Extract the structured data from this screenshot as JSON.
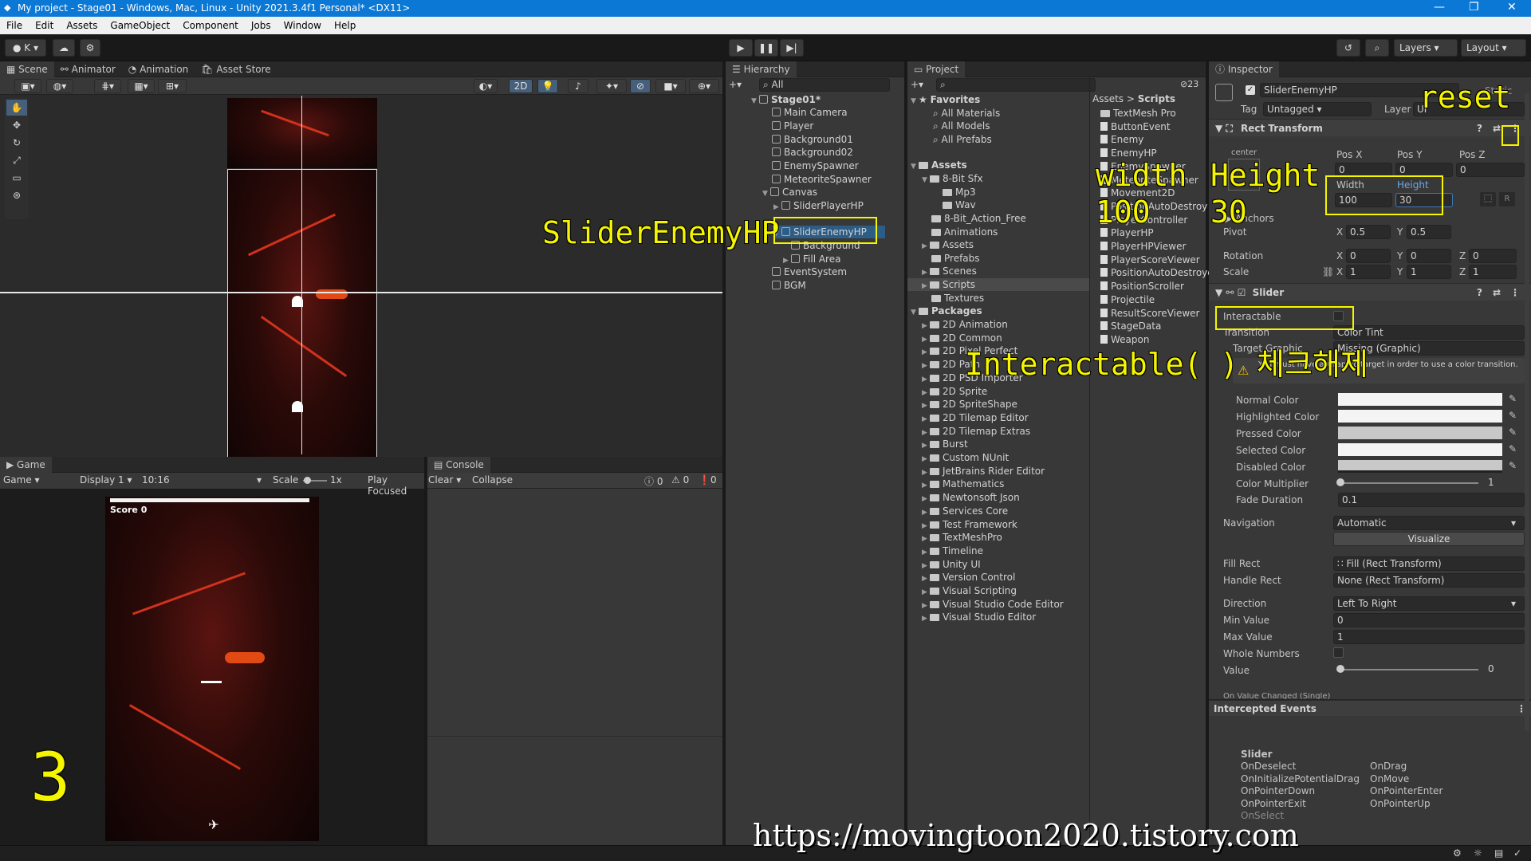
{
  "window": {
    "title": "My project - Stage01 - Windows, Mac, Linux - Unity 2021.3.4f1 Personal* <DX11>"
  },
  "menu": [
    "File",
    "Edit",
    "Assets",
    "GameObject",
    "Component",
    "Jobs",
    "Window",
    "Help"
  ],
  "toolbar": {
    "account": "K",
    "layers": "Layers",
    "layout": "Layout"
  },
  "scene_tabs": [
    "Scene",
    "Animator",
    "Animation",
    "Asset Store"
  ],
  "scene_toolbar": {
    "mode2d": "2D"
  },
  "game": {
    "tabs": [
      "Game"
    ],
    "view": "Game",
    "display": "Display 1",
    "aspect": "10:16",
    "scale_label": "Scale",
    "scale_value": "1x",
    "play_focused": "Play Focused",
    "score": "Score 0"
  },
  "console": {
    "tab": "Console",
    "clear": "Clear",
    "collapse": "Collapse",
    "counts": [
      "0",
      "0",
      "0"
    ]
  },
  "hierarchy": {
    "tab": "Hierarchy",
    "search": "All",
    "items": [
      "Stage01*",
      "Main Camera",
      "Player",
      "Background01",
      "Background02",
      "EnemySpawner",
      "MeteoriteSpawner",
      "Canvas",
      "SliderPlayerHP",
      "SliderEnemyHP",
      "Background",
      "Fill Area",
      "EventSystem",
      "BGM"
    ]
  },
  "project": {
    "tab": "Project",
    "count": "23",
    "favorites": [
      "Favorites",
      "All Materials",
      "All Models",
      "All Prefabs"
    ],
    "assets": [
      "Assets",
      "8-Bit Sfx",
      "Mp3",
      "Wav",
      "8-Bit_Action_Free",
      "Animations",
      "Assets",
      "Prefabs",
      "Scenes",
      "Scripts",
      "Textures"
    ],
    "packages": [
      "Packages",
      "2D Animation",
      "2D Common",
      "2D Pixel Perfect",
      "2D Path",
      "2D PSD Importer",
      "2D Sprite",
      "2D SpriteShape",
      "2D Tilemap Editor",
      "2D Tilemap Extras",
      "Burst",
      "Custom NUnit",
      "JetBrains Rider Editor",
      "Mathematics",
      "Newtonsoft Json",
      "Services Core",
      "Test Framework",
      "TextMeshPro",
      "Timeline",
      "Unity UI",
      "Version Control",
      "Visual Scripting",
      "Visual Studio Code Editor",
      "Visual Studio Editor"
    ],
    "breadcrumb": [
      "Assets",
      "Scripts"
    ],
    "scripts": [
      "TextMesh Pro",
      "ButtonEvent",
      "Enemy",
      "EnemyHP",
      "EnemySpawner",
      "MeteoriteSpawner",
      "Movement2D",
      "PositionAutoDestroy",
      "PlayerController",
      "PlayerHP",
      "PlayerHPViewer",
      "PlayerScoreViewer",
      "PositionAutoDestroyer",
      "PositionScroller",
      "Projectile",
      "ResultScoreViewer",
      "StageData",
      "Weapon"
    ]
  },
  "inspector": {
    "tab": "Inspector",
    "name": "SliderEnemyHP",
    "static": "Static",
    "tag_label": "Tag",
    "tag": "Untagged",
    "layer_label": "Layer",
    "layer": "UI",
    "rect": {
      "title": "Rect Transform",
      "anchor": "center",
      "posx_label": "Pos X",
      "posy_label": "Pos Y",
      "posz_label": "Pos Z",
      "posx": "0",
      "posy": "0",
      "posz": "0",
      "width_label": "Width",
      "height_label": "Height",
      "width": "100",
      "height": "30",
      "anchors": "Anchors",
      "pivot": "Pivot",
      "rotation": "Rotation",
      "scale": "Scale",
      "pivot_x": "0.5",
      "pivot_y": "0.5",
      "rot_x": "0",
      "rot_y": "0",
      "rot_z": "0",
      "scale_x": "1",
      "scale_y": "1",
      "scale_z": "1"
    },
    "slider": {
      "title": "Slider",
      "interactable": "Interactable",
      "transition_label": "Transition",
      "transition": "Color Tint",
      "target_label": "Target Graphic",
      "target": "Missing (Graphic)",
      "warning": "You must have a Graphic target in order to use a color transition.",
      "normal": "Normal Color",
      "highlighted": "Highlighted Color",
      "pressed": "Pressed Color",
      "selected": "Selected Color",
      "disabled": "Disabled Color",
      "multiplier_label": "Color Multiplier",
      "multiplier": "1",
      "fade_label": "Fade Duration",
      "fade": "0.1",
      "navigation_label": "Navigation",
      "navigation": "Automatic",
      "visualize": "Visualize",
      "fill_label": "Fill Rect",
      "fill": "Fill (Rect Transform)",
      "handle_label": "Handle Rect",
      "handle": "None (Rect Transform)",
      "direction_label": "Direction",
      "direction": "Left To Right",
      "min_label": "Min Value",
      "min": "0",
      "max_label": "Max Value",
      "max": "1",
      "whole_label": "Whole Numbers",
      "value_label": "Value",
      "value": "0",
      "onchange": "On Value Changed (Single)"
    },
    "events": {
      "title": "Intercepted Events",
      "group": "Slider",
      "left": [
        "OnDeselect",
        "OnInitializePotentialDrag",
        "OnPointerDown",
        "OnPointerExit",
        "OnSelect"
      ],
      "right": [
        "OnDrag",
        "OnMove",
        "OnPointerEnter",
        "OnPointerUp"
      ]
    }
  },
  "annotations": {
    "slider_name": "SliderEnemyHP",
    "width": "width",
    "width_val": "100",
    "height": "Height",
    "height_val": "30",
    "interactable": "Interactable( ) 체크해제",
    "reset": "reset",
    "step": "3",
    "url": "https://movingtoon2020.tistory.com"
  },
  "colors": {
    "accent": "#0a78d4",
    "highlight": "#f5f500",
    "selection": "#2c5d87"
  }
}
